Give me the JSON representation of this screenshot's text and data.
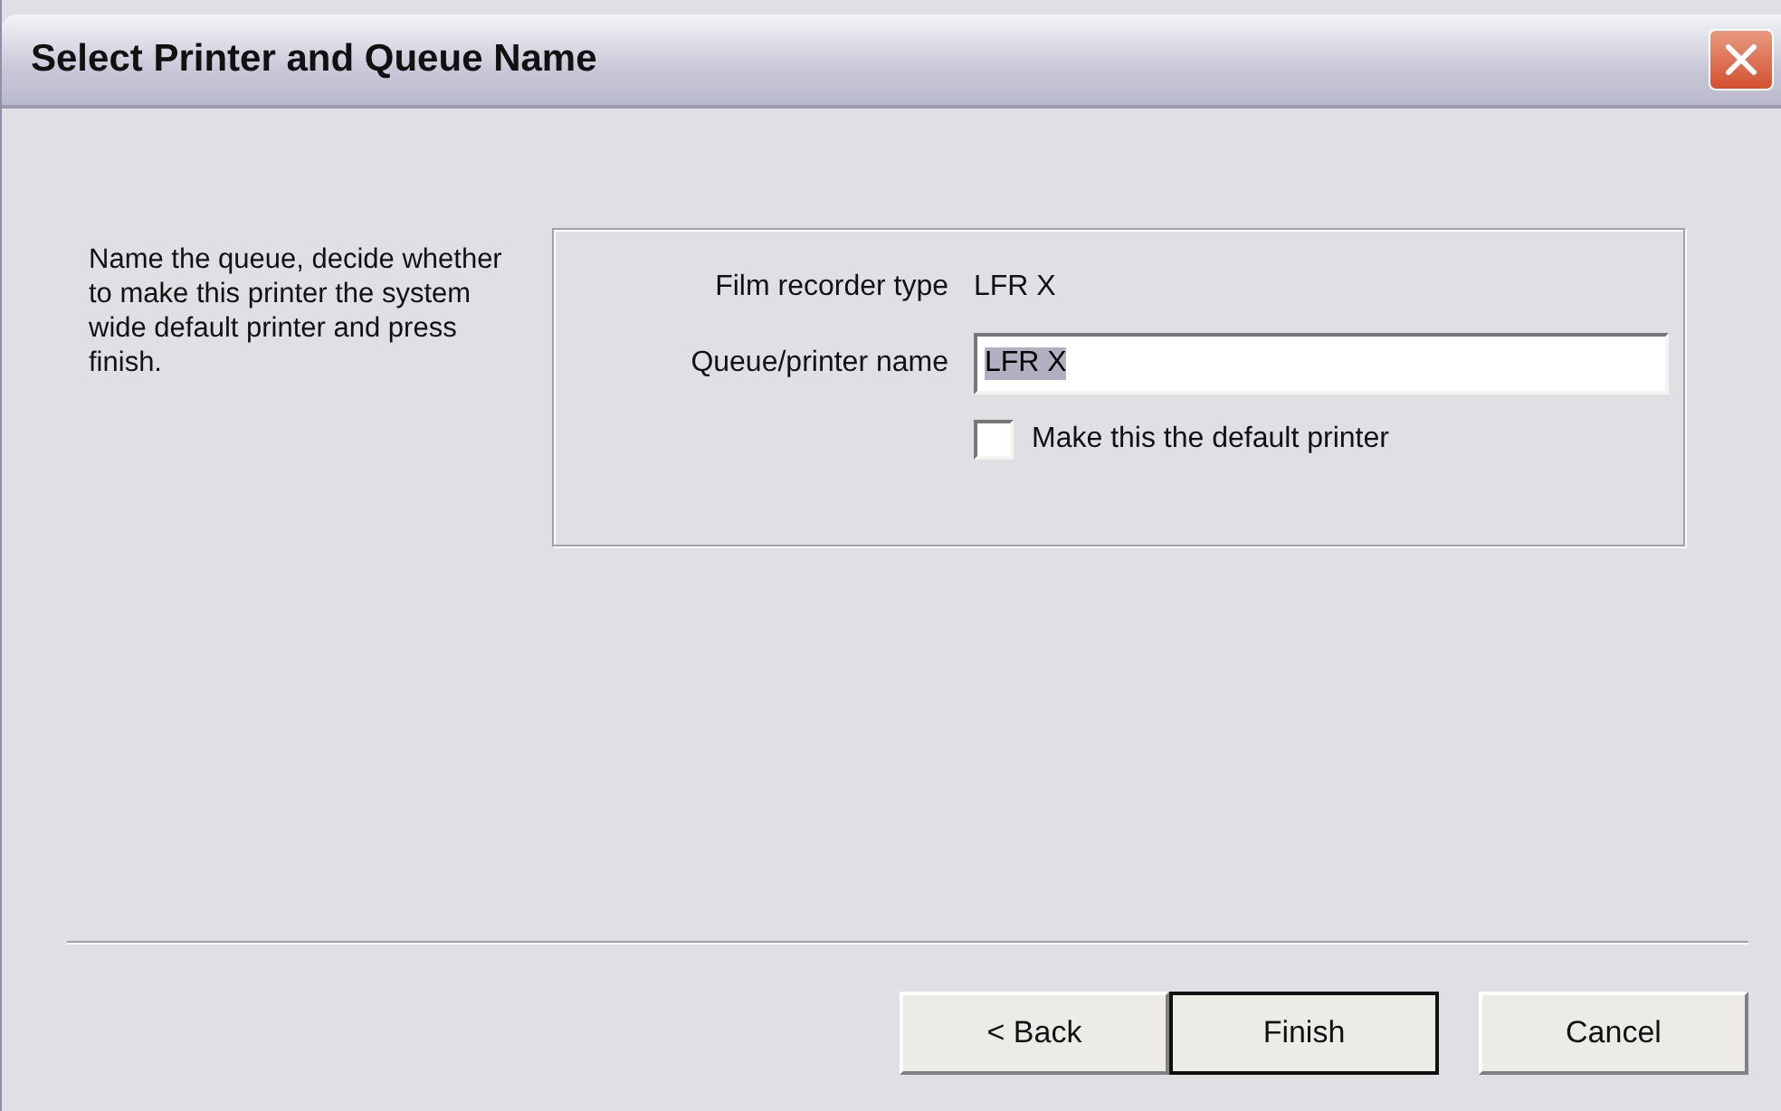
{
  "window": {
    "title": "Select Printer and Queue Name"
  },
  "instructions": "Name the queue, decide whether to make this printer the system wide default printer and press finish.",
  "form": {
    "recorder_type_label": "Film recorder type",
    "recorder_type": "LFR X",
    "queue_label": "Queue/printer name",
    "queue_value": "LFR X",
    "queue_value_selected": true,
    "default_checkbox": {
      "label": "Make this the default printer",
      "checked": false
    }
  },
  "buttons": [
    {
      "label": "< Back",
      "default": false
    },
    {
      "label": "Finish",
      "default": true
    },
    {
      "label": "Cancel",
      "default": false
    }
  ]
}
